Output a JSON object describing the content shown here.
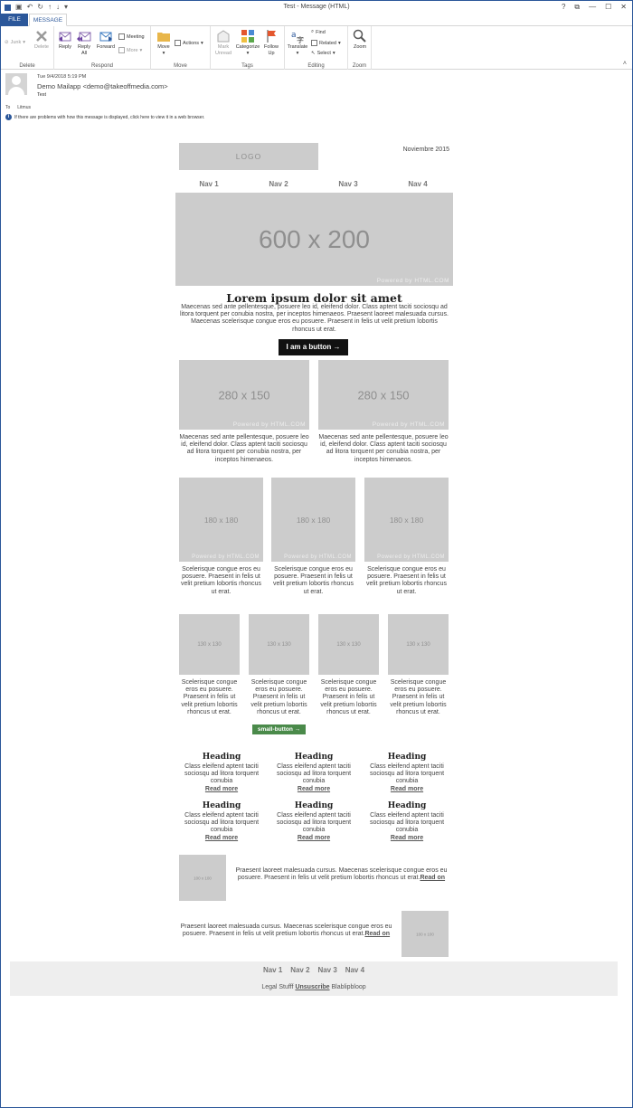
{
  "window": {
    "title": "Test - Message (HTML)",
    "controls": [
      "?",
      "⧉",
      "—",
      "☐",
      "✕"
    ]
  },
  "tabs": {
    "file": "FILE",
    "message": "MESSAGE"
  },
  "ribbon": {
    "junk": "Junk",
    "delete": "Delete",
    "reply": "Reply",
    "reply_all": "Reply All",
    "forward": "Forward",
    "meeting": "Meeting",
    "more": "More",
    "move": "Move",
    "actions": "Actions",
    "mark_unread": "Mark Unread",
    "categorize": "Categorize",
    "follow_up": "Follow Up",
    "translate": "Translate",
    "find": "Find",
    "related": "Related",
    "select": "Select",
    "zoom": "Zoom",
    "groups": {
      "delete": "Delete",
      "respond": "Respond",
      "move": "Move",
      "tags": "Tags",
      "editing": "Editing",
      "zoom": "Zoom"
    }
  },
  "header": {
    "date": "Tue 9/4/2018 5:19 PM",
    "from": "Demo Mailapp <demo@takeoffmedia.com>",
    "subject": "Test",
    "to_label": "To",
    "to_value": "Litmus",
    "info": "If there are problems with how this message is displayed, click here to view it in a web browser."
  },
  "email": {
    "logo": "LOGO",
    "date": "Noviembre 2015",
    "nav": [
      "Nav 1",
      "Nav 2",
      "Nav 3",
      "Nav 4"
    ],
    "hero": "600 x 200",
    "powered": "Powered by HTML.COM",
    "title": "Lorem ipsum dolor sit amet",
    "intro": "Maecenas sed ante pellentesque, posuere leo id, eleifend dolor. Class aptent taciti sociosqu ad litora torquent per conubia nostra, per inceptos himenaeos. Praesent laoreet malesuada cursus. Maecenas scelerisque congue eros eu posuere. Praesent in felis ut velit pretium lobortis rhoncus ut erat.",
    "button": "I am a button →",
    "two_col": {
      "img": "280 x 150",
      "text": "Maecenas sed ante pellentesque, posuere leo id, eleifend dolor. Class aptent taciti sociosqu ad litora torquent per conubia nostra, per inceptos himenaeos."
    },
    "three_col": {
      "img": "180 x 180",
      "text": "Scelerisque congue eros eu posuere. Praesent in felis ut velit pretium lobortis rhoncus ut erat."
    },
    "four_col": {
      "img": "130 x 130",
      "text": "Scelerisque congue eros eu posuere. Praesent in felis ut velit pretium lobortis rhoncus ut erat."
    },
    "small_button": "small-button →",
    "headings": {
      "heading": "Heading",
      "text": "Class eleifend aptent taciti sociosqu ad litora torquent conubia",
      "read_more": "Read more"
    },
    "left_img": {
      "img": "100 x 100",
      "text": "Praesent laoreet malesuada cursus. Maecenas scelerisque congue eros eu posuere. Praesent in felis ut velit pretium lobortis rhoncus ut erat.",
      "link": "Read on"
    },
    "right_img": {
      "img": "100 x 100",
      "text": "Praesent laoreet malesuada cursus. Maecenas scelerisque congue eros eu posuere. Praesent in felis ut velit pretium lobortis rhoncus ut erat.",
      "link": "Read on"
    },
    "footer": {
      "nav": [
        "Nav 1",
        "Nav 2",
        "Nav 3",
        "Nav 4"
      ],
      "legal": "Legal Stufff",
      "unsubscribe": "Unsuscribe",
      "extra": "Blablipbloop"
    }
  },
  "colors": {
    "accent": "#2b579a",
    "placeholder": "#cccccc",
    "button": "#111111",
    "small_button": "#4a8a4a",
    "footer_bg": "#eeeeee"
  }
}
